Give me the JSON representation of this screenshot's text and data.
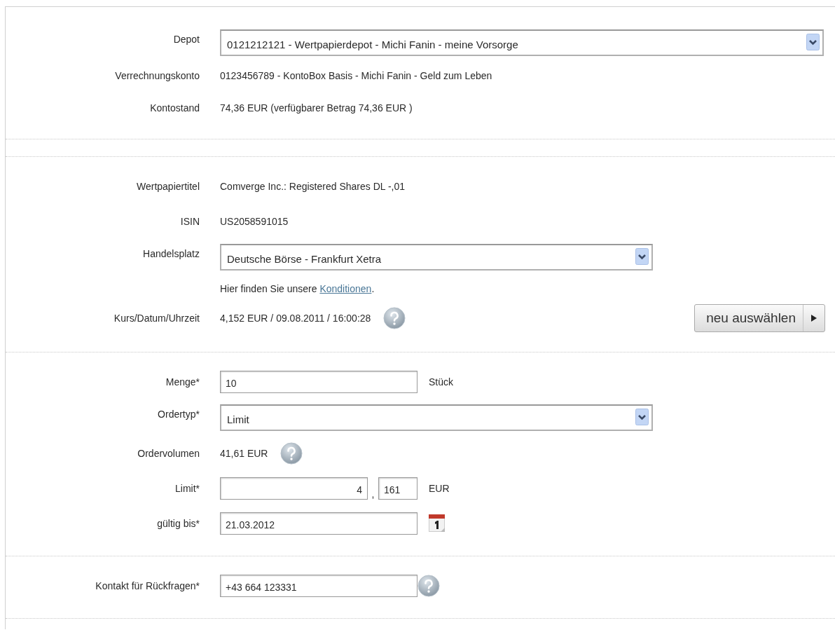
{
  "sections": [
    {
      "rows": [
        {
          "kind": "select",
          "label": "Depot",
          "value": "0121212121 - Wertpapierdepot - Michi Fanin - meine Vorsorge"
        },
        {
          "kind": "text",
          "label": "Verrechnungskonto",
          "value": "0123456789 - KontoBox Basis - Michi Fanin - Geld zum Leben"
        },
        {
          "kind": "text",
          "label": "Kontostand",
          "value": "74,36 EUR (verfügbarer Betrag  74,36 EUR )"
        }
      ]
    },
    {
      "rows": [
        {
          "kind": "text",
          "label": "Wertpapiertitel",
          "value": "Comverge Inc.: Registered Shares DL -,01"
        },
        {
          "kind": "text",
          "label": "ISIN",
          "value": "US2058591015"
        },
        {
          "kind": "select",
          "label": "Handelsplatz",
          "value": "Deutsche Börse - Frankfurt Xetra",
          "hint": {
            "before": "Hier finden Sie unsere ",
            "link": "Konditionen",
            "after": "."
          }
        },
        {
          "kind": "text",
          "label": "Kurs/Datum/Uhrzeit",
          "value": "4,152 EUR / 09.08.2011 / 16:00:28",
          "help": true,
          "button": "neu auswählen"
        }
      ]
    },
    {
      "rows": [
        {
          "kind": "input",
          "label": "Menge*",
          "value": "10",
          "unit": "Stück"
        },
        {
          "kind": "select",
          "label": "Ordertyp*",
          "value": "Limit"
        },
        {
          "kind": "text",
          "label": "Ordervolumen",
          "value": "41,61 EUR",
          "help": true
        },
        {
          "kind": "split",
          "label": "Limit*",
          "integer": "4",
          "separator": ",",
          "fraction": "161",
          "unit": "EUR"
        },
        {
          "kind": "date",
          "label": "gültig bis*",
          "value": "21.03.2012"
        }
      ]
    },
    {
      "rows": [
        {
          "kind": "input",
          "label": "Kontakt für Rückfragen*",
          "value": "+43 664 123331",
          "help": true
        }
      ]
    }
  ]
}
